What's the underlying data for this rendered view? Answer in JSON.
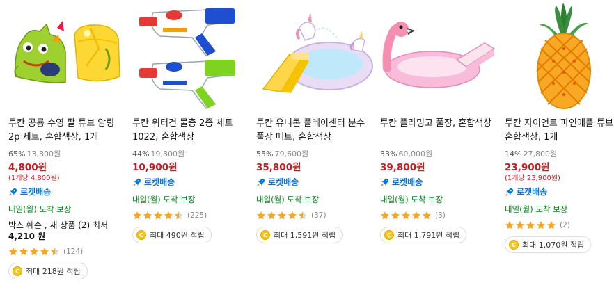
{
  "accent_colors": {
    "price": "#c9191e",
    "rocket": "#0073e9",
    "arrival": "#00891a",
    "star": "#f5a623"
  },
  "products": [
    {
      "image_icon": "arm-float-image",
      "title": "투칸 공룡 수영 팔 튜브 암링 2p 세트, 혼합색상, 1개",
      "discount": "65%",
      "original_price": "13,800원",
      "price": "4,800원",
      "unit_price": "(1개당 4,800원)",
      "rocket": "로켓배송",
      "arrival": "내일(월) 도착 보장",
      "used_offer": "박스 훼손 , 새 상품 (2) 최저",
      "used_price": "4,210 원",
      "rating": 4.5,
      "review_count": "(124)",
      "points": "최대 218원 적립"
    },
    {
      "image_icon": "water-gun-image",
      "title": "투칸 워터건 물총 2종 세트 1022, 혼합색상",
      "discount": "44%",
      "original_price": "19,800원",
      "price": "10,900원",
      "unit_price": "",
      "rocket": "로켓배송",
      "arrival": "내일(월) 도착 보장",
      "used_offer": "",
      "used_price": "",
      "rating": 4.5,
      "review_count": "(225)",
      "points": "최대 490원 적립"
    },
    {
      "image_icon": "unicorn-pool-image",
      "title": "투칸 유니콘 플레이센터 분수 풀장 매트, 혼합색상",
      "discount": "55%",
      "original_price": "79,600원",
      "price": "35,800원",
      "unit_price": "",
      "rocket": "로켓배송",
      "arrival": "내일(월) 도착 보장",
      "used_offer": "",
      "used_price": "",
      "rating": 4.5,
      "review_count": "(37)",
      "points": "최대 1,591원 적립"
    },
    {
      "image_icon": "flamingo-pool-image",
      "title": "투칸 플라밍고 풀장, 혼합색상",
      "discount": "33%",
      "original_price": "60,000원",
      "price": "39,800원",
      "unit_price": "",
      "rocket": "로켓배송",
      "arrival": "내일(월) 도착 보장",
      "used_offer": "",
      "used_price": "",
      "rating": 5,
      "review_count": "(3)",
      "points": "최대 1,791원 적립"
    },
    {
      "image_icon": "pineapple-tube-image",
      "title": "투칸 자이언트 파인애플 튜브, 혼합색상, 1개",
      "discount": "14%",
      "original_price": "27,800원",
      "price": "23,900원",
      "unit_price": "(1개당 23,900원)",
      "rocket": "로켓배송",
      "arrival": "내일(월) 도착 보장",
      "used_offer": "",
      "used_price": "",
      "rating": 5,
      "review_count": "(2)",
      "points": "최대 1,070원 적립"
    }
  ]
}
